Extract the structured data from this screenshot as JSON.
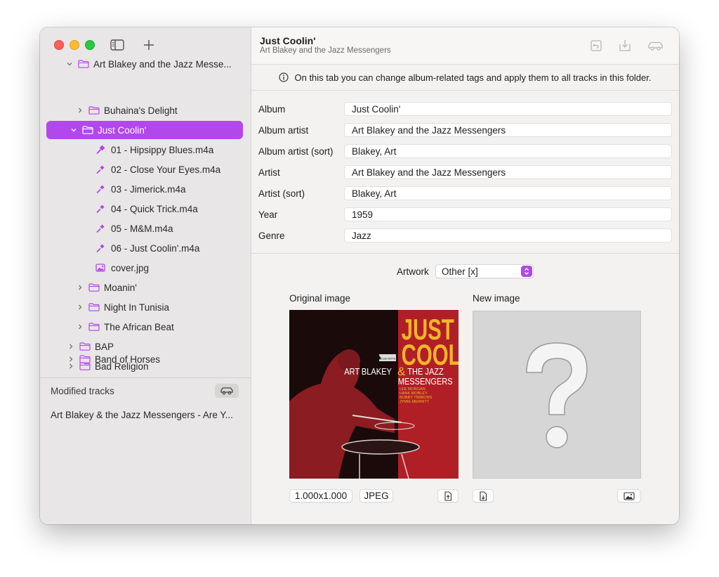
{
  "sidebar": {
    "tree": [
      {
        "label": "Art Blakey and the Jazz Messe...",
        "type": "folder",
        "expanded": true,
        "level": 1
      },
      {
        "label": "Buhaina's Delight",
        "type": "folder",
        "expanded": false,
        "level": 2
      },
      {
        "label": "Just Coolin'",
        "type": "folder",
        "expanded": true,
        "level": 2,
        "selected": true
      },
      {
        "label": "01 - Hipsippy Blues.m4a",
        "type": "audio",
        "level": 3
      },
      {
        "label": "02 - Close Your Eyes.m4a",
        "type": "audio",
        "level": 3
      },
      {
        "label": "03 - Jimerick.m4a",
        "type": "audio",
        "level": 3
      },
      {
        "label": "04 - Quick Trick.m4a",
        "type": "audio",
        "level": 3
      },
      {
        "label": "05 - M&M.m4a",
        "type": "audio",
        "level": 3
      },
      {
        "label": "06 - Just Coolin'.m4a",
        "type": "audio",
        "level": 3
      },
      {
        "label": "cover.jpg",
        "type": "image",
        "level": 3
      },
      {
        "label": "Moanin'",
        "type": "folder",
        "expanded": false,
        "level": 2
      },
      {
        "label": "Night In Tunisia",
        "type": "folder",
        "expanded": false,
        "level": 2
      },
      {
        "label": "The African Beat",
        "type": "folder",
        "expanded": false,
        "level": 2
      },
      {
        "label": "BAP",
        "type": "folder",
        "expanded": false,
        "level": 1
      },
      {
        "label": "Bad Religion",
        "type": "folder",
        "expanded": false,
        "level": 1
      },
      {
        "label": "Band of Horses",
        "type": "folder",
        "expanded": false,
        "level": 1
      }
    ],
    "modified_label": "Modified tracks",
    "modified_tracks": [
      "Art Blakey & the Jazz Messengers - Are Y..."
    ]
  },
  "header": {
    "title": "Just Coolin'",
    "subtitle": "Art Blakey and the Jazz Messengers"
  },
  "info": {
    "text": "On this tab you can change album-related tags and apply them to all tracks in this folder."
  },
  "fields": [
    {
      "label": "Album",
      "value": "Just Coolin'"
    },
    {
      "label": "Album artist",
      "value": "Art Blakey and the Jazz Messengers"
    },
    {
      "label": "Album artist (sort)",
      "value": "Blakey, Art"
    },
    {
      "label": "Artist",
      "value": "Art Blakey and the Jazz Messengers"
    },
    {
      "label": "Artist (sort)",
      "value": "Blakey, Art"
    },
    {
      "label": "Year",
      "value": "1959"
    },
    {
      "label": "Genre",
      "value": "Jazz"
    }
  ],
  "artwork": {
    "label": "Artwork",
    "selected": "Other [x]",
    "original_label": "Original image",
    "new_label": "New image",
    "dimensions": "1.000x1.000",
    "format": "JPEG",
    "cover_text": {
      "title_line1": "JUST",
      "title_line2": "COOLIN'",
      "artist_left": "ART BLAKEY",
      "artist_amp": "&",
      "artist_right1": "THE JAZZ",
      "artist_right2": "MESSENGERS",
      "credits": [
        "LEE MORGAN",
        "HANK MOBLEY",
        "BOBBY TIMMONS",
        "JYMIE MERRITT"
      ],
      "label": "BLUE NOTE"
    }
  },
  "colors": {
    "accent": "#b247ec",
    "cover_red": "#b01f26",
    "cover_yellow": "#f2b42a"
  }
}
